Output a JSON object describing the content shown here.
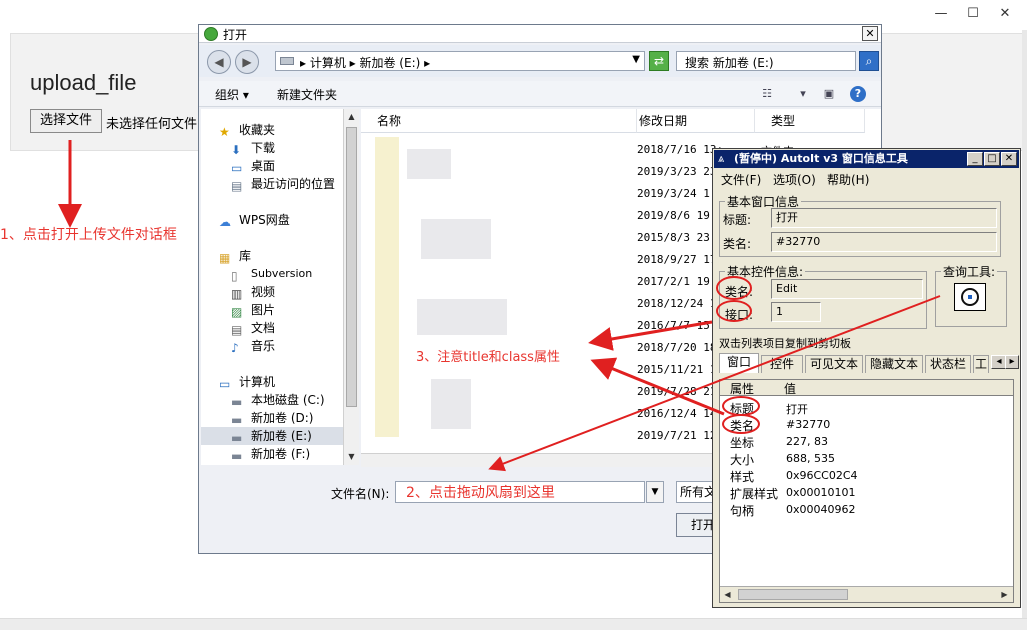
{
  "browser": {
    "controls": {
      "minimize": "—",
      "maximize": "☐",
      "close": "✕"
    }
  },
  "page": {
    "title": "upload_file",
    "choose_button": "选择文件",
    "no_file_text": "未选择任何文件"
  },
  "open_dialog": {
    "title": "打开",
    "close": "✕",
    "address": "▸ 计算机 ▸ 新加卷 (E:) ▸",
    "search_placeholder": "搜索 新加卷 (E:)",
    "toolbar": {
      "organize": "组织 ▾",
      "new_folder": "新建文件夹"
    },
    "nav": {
      "favorites": "收藏夹",
      "downloads": "下载",
      "desktop": "桌面",
      "recent": "最近访问的位置",
      "wps": "WPS网盘",
      "libraries": "库",
      "subversion": "Subversion",
      "videos": "视频",
      "pictures": "图片",
      "documents": "文档",
      "music": "音乐",
      "computer": "计算机",
      "drive_c": "本地磁盘 (C:)",
      "drive_d": "新加卷 (D:)",
      "drive_e": "新加卷 (E:)",
      "drive_f": "新加卷 (F:)"
    },
    "columns": {
      "name": "名称",
      "date": "修改日期",
      "type": "类型"
    },
    "dates": [
      "2018/7/16 13:",
      "2019/3/23 23",
      "2019/3/24 1:",
      "2019/8/6 19:",
      "2015/8/3 23:",
      "2018/9/27 17",
      "2017/2/1 19:",
      "2018/12/24 1",
      "2016/7/7 15:",
      "2018/7/20 18",
      "2015/11/21 1",
      "2019/7/28 21",
      "2016/12/4 14",
      "2019/7/21 12"
    ],
    "first_type": "文件夹",
    "file_name_label": "文件名(N):",
    "file_type": "所有文",
    "open_button": "打开"
  },
  "autoit": {
    "title": "(暂停中) AutoIt v3 窗口信息工具",
    "menu": {
      "file": "文件(F)",
      "options": "选项(O)",
      "help": "帮助(H)"
    },
    "basic_window": {
      "label": "基本窗口信息",
      "title_label": "标题:",
      "title_value": "打开",
      "class_label": "类名:",
      "class_value": "#32770"
    },
    "basic_control": {
      "label": "基本控件信息:",
      "class_label": "类名:",
      "class_value": "Edit",
      "instance_label": "接口:",
      "instance_value": "1"
    },
    "finder_label": "查询工具:",
    "hint": "双击列表项目复制到剪切板",
    "tabs": [
      "窗口",
      "控件",
      "可见文本",
      "隐藏文本",
      "状态栏",
      "工"
    ],
    "table_headers": {
      "prop": "属性",
      "value": "值"
    },
    "props": [
      {
        "name": "标题",
        "value": "打开"
      },
      {
        "name": "类名",
        "value": "#32770"
      },
      {
        "name": "坐标",
        "value": "227, 83"
      },
      {
        "name": "大小",
        "value": "688, 535"
      },
      {
        "name": "样式",
        "value": "0x96CC02C4"
      },
      {
        "name": "扩展样式",
        "value": "0x00010101"
      },
      {
        "name": "句柄",
        "value": "0x00040962"
      }
    ]
  },
  "annotations": {
    "step1": "1、点击打开上传文件对话框",
    "step2": "2、点击拖动风扇到这里",
    "step3": "3、注意title和class属性"
  },
  "colors": {
    "annotation": "#e8352f",
    "autoit_title": "#0a246a"
  }
}
